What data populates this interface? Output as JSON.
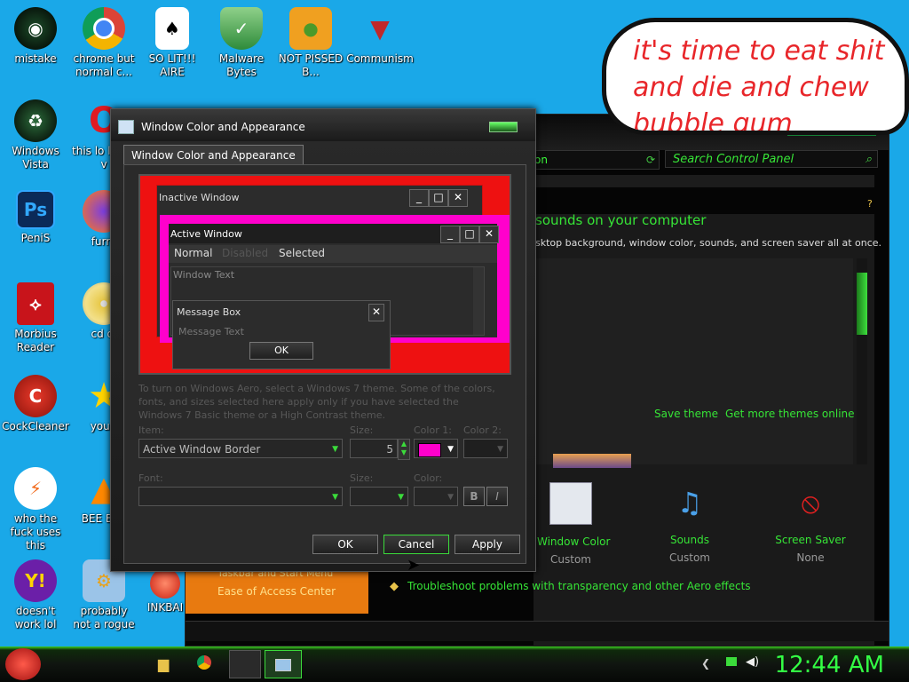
{
  "desktop": {
    "icons": [
      {
        "label": "mistake"
      },
      {
        "label": "chrome but normal c..."
      },
      {
        "label": "SO LIT!!! AIRE"
      },
      {
        "label": "Malware Bytes"
      },
      {
        "label": "NOT PISSED B..."
      },
      {
        "label": "Communism"
      },
      {
        "label": "Windows Vista"
      },
      {
        "label": "this lo like a v"
      },
      {
        "label": "PeniS"
      },
      {
        "label": "furry"
      },
      {
        "label": "Morbius Reader"
      },
      {
        "label": "cd di"
      },
      {
        "label": "CockCleaner"
      },
      {
        "label": "you t"
      },
      {
        "label": "who the fuck uses this"
      },
      {
        "label": "BEE BEE"
      },
      {
        "label": "doesn't work lol"
      },
      {
        "label": "probably not a rogue"
      },
      {
        "label": "INKBAI"
      }
    ],
    "speech_bubble": "it's time to eat shit and die and chew bubble gum"
  },
  "control_panel": {
    "search_placeholder": "Search Control Panel",
    "address_text": "on",
    "heading": "sounds on your computer",
    "subtext": "sktop background, window color, sounds, and screen saver all at once.",
    "save_theme": "Save theme",
    "get_more_themes": "Get more themes online",
    "items": [
      {
        "label": "Window Color",
        "value": "Custom"
      },
      {
        "label": "Sounds",
        "value": "Custom"
      },
      {
        "label": "Screen Saver",
        "value": "None"
      }
    ],
    "troubleshoot": "Troubleshoot problems with transparency and other Aero effects",
    "left_link1": "Taskbar and Start Menu",
    "left_link2": "Ease of Access Center"
  },
  "dialog": {
    "title": "Window Color and Appearance",
    "tab": "Window Color and Appearance",
    "preview": {
      "inactive_title": "Inactive Window",
      "active_title": "Active Window",
      "menu_normal": "Normal",
      "menu_disabled": "Disabled",
      "menu_selected": "Selected",
      "window_text": "Window Text",
      "msgbox_title": "Message Box",
      "msgbox_text": "Message Text",
      "msgbox_ok": "OK"
    },
    "description": "To turn on Windows Aero, select a Windows 7 theme. Some of the colors, fonts, and sizes selected here apply only if you have selected the Windows 7 Basic theme or a High Contrast theme.",
    "item_label": "Item:",
    "item_value": "Active Window Border",
    "size_label": "Size:",
    "size_value": "5",
    "color1_label": "Color 1:",
    "color2_label": "Color 2:",
    "color1_hex": "#ff00cc",
    "font_label": "Font:",
    "font_size_label": "Size:",
    "font_color_label": "Color:",
    "bold": "B",
    "italic": "I",
    "ok": "OK",
    "cancel": "Cancel",
    "apply": "Apply"
  },
  "taskbar": {
    "clock": "12:44 AM"
  }
}
